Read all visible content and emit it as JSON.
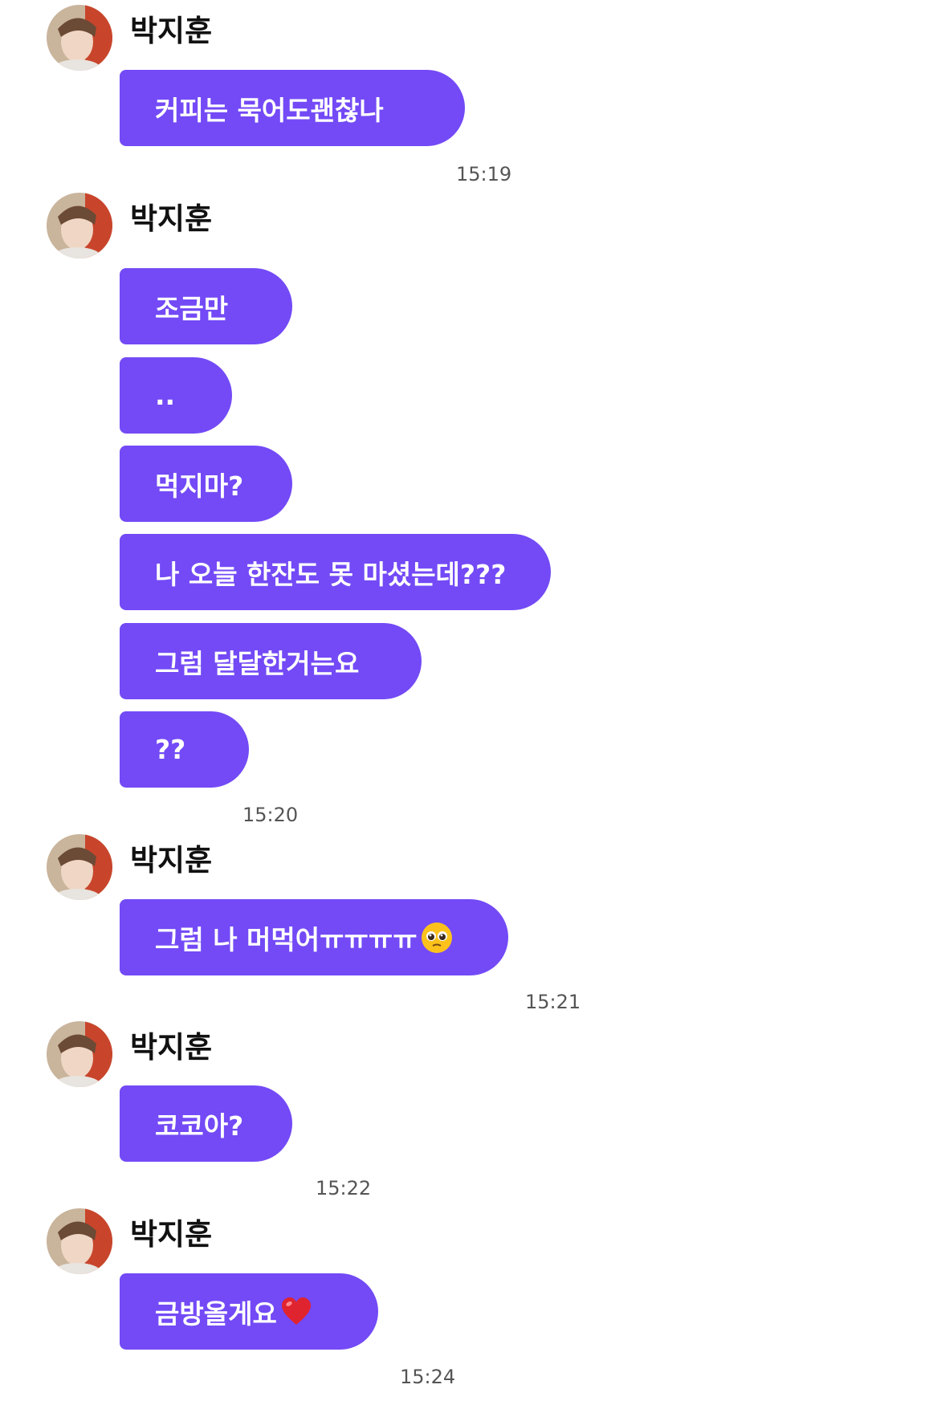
{
  "sender": {
    "name": "박지훈",
    "bubble_color": "#734af6"
  },
  "messages": [
    {
      "text": "커피는 묵어도괜찮나"
    },
    {
      "text": "조금만"
    },
    {
      "text": ".."
    },
    {
      "text": "먹지마?"
    },
    {
      "text": "나 오늘 한잔도 못 마셨는데???"
    },
    {
      "text": "그럼 달달한거는요"
    },
    {
      "text": "??"
    },
    {
      "text": "그럼 나 머먹어ㅠㅠㅠㅠ",
      "emoji": "pleading-face-emoji"
    },
    {
      "text": "코코아?"
    },
    {
      "text": "금방올게요",
      "emoji": "red-heart-emoji"
    }
  ],
  "timestamps": [
    "15:19",
    "15:20",
    "15:21",
    "15:22",
    "15:24"
  ]
}
